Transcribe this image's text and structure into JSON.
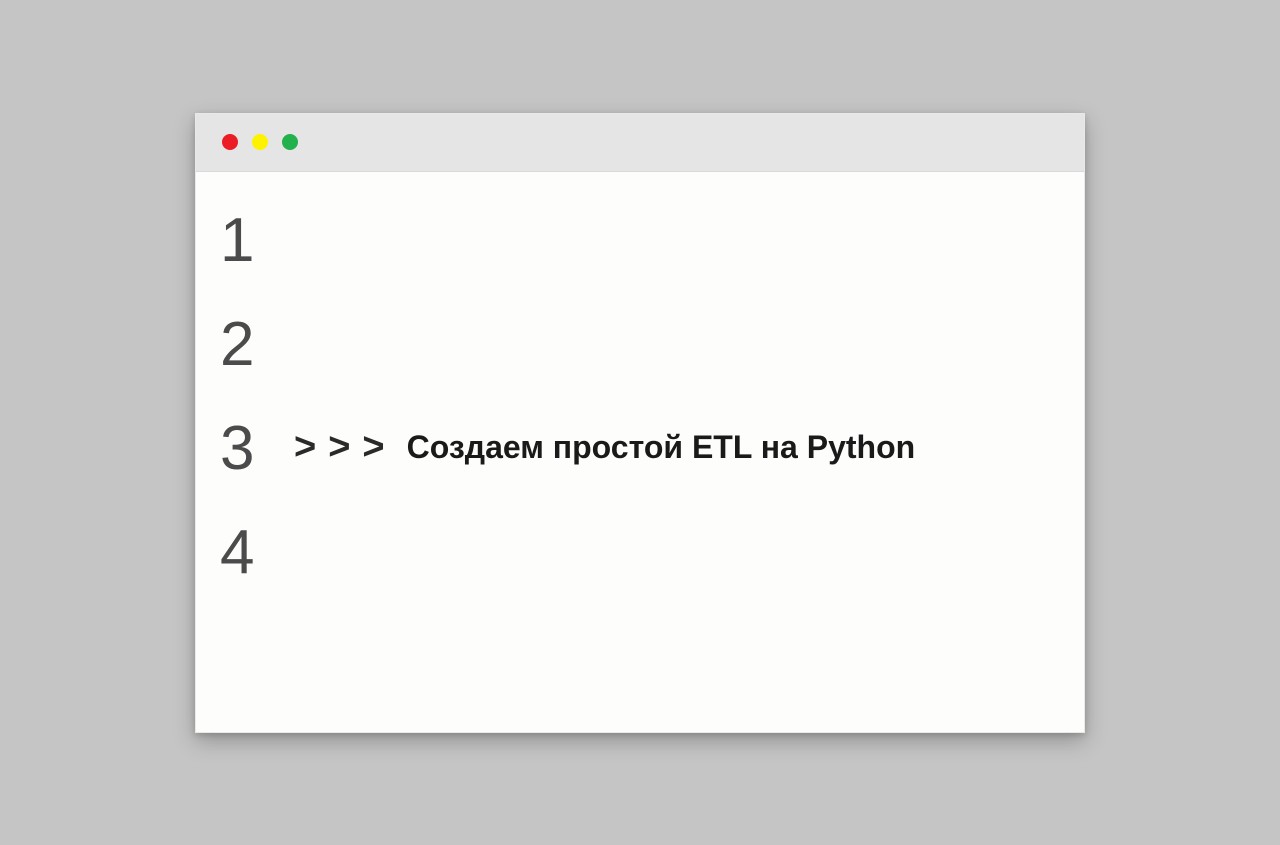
{
  "window": {
    "traffic_lights": {
      "red": "#ec1c24",
      "yellow": "#fff200",
      "green": "#22b14c"
    }
  },
  "editor": {
    "line_numbers": [
      "1",
      "2",
      "3",
      "4"
    ],
    "prompt_chevron": ">",
    "content_text": "Создаем простой ETL на Python"
  }
}
